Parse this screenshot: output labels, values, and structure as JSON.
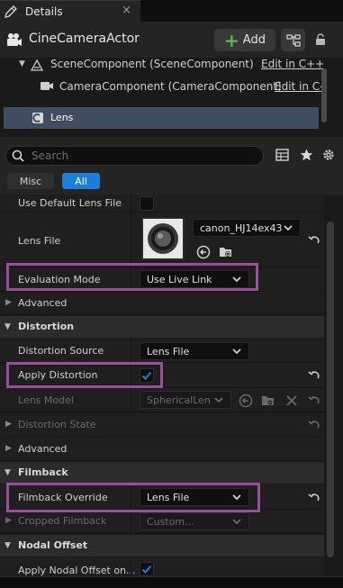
{
  "tab": {
    "title": "Details",
    "close": "×"
  },
  "actor": {
    "name": "CineCameraActor",
    "add_label": "Add"
  },
  "components": [
    {
      "label": "SceneComponent (SceneComponent)",
      "edit": "Edit in C++"
    },
    {
      "label": "CameraComponent (CameraComponent)",
      "edit": "Edit in C-"
    },
    {
      "label": "Lens"
    }
  ],
  "search": {
    "placeholder": "Search"
  },
  "filters": {
    "misc": "Misc",
    "all": "All"
  },
  "properties": {
    "use_default_lens_file": {
      "label": "Use Default Lens File",
      "checked": false
    },
    "lens_file": {
      "label": "Lens File",
      "value": "canon_HJ14ex43"
    },
    "evaluation_mode": {
      "label": "Evaluation Mode",
      "value": "Use Live Link"
    },
    "advanced_1": "Advanced",
    "distortion_category": "Distortion",
    "distortion_source": {
      "label": "Distortion Source",
      "value": "Lens File"
    },
    "apply_distortion": {
      "label": "Apply Distortion",
      "checked": true
    },
    "lens_model": {
      "label": "Lens Model",
      "value": "SphericalLen"
    },
    "distortion_state": "Distortion State",
    "advanced_2": "Advanced",
    "filmback_category": "Filmback",
    "filmback_override": {
      "label": "Filmback Override",
      "value": "Lens File"
    },
    "cropped_filmback": {
      "label": "Cropped Filmback",
      "value": "Custom..."
    },
    "nodal_offset_category": "Nodal Offset",
    "apply_nodal_offset": {
      "label": "Apply Nodal Offset on...",
      "checked": true
    }
  },
  "colors": {
    "accent": "#1a7fd6",
    "highlight": "#9b4d9e",
    "selected_row": "#3f4d60",
    "add_plus": "#5cb84a"
  }
}
